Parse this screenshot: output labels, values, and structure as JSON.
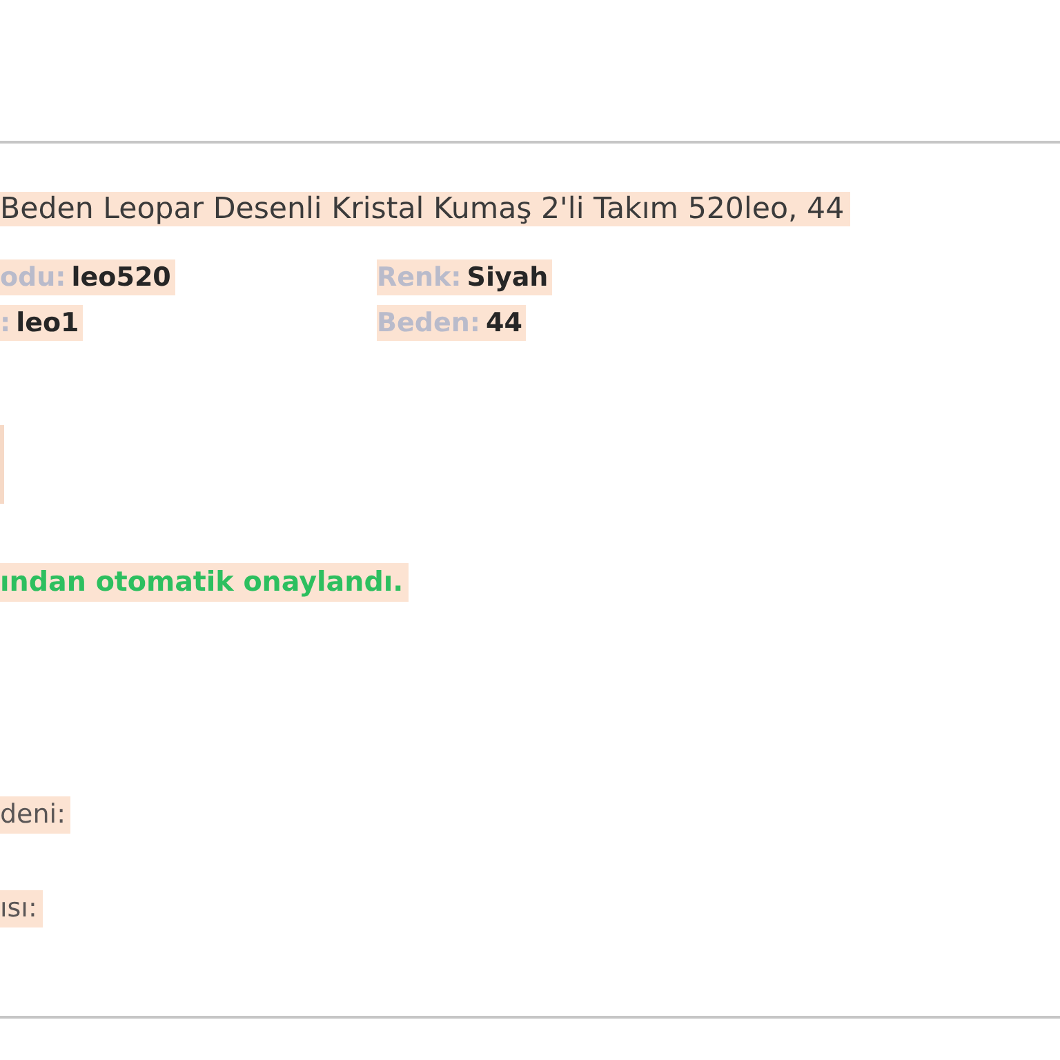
{
  "product_title": "Beden Leopar Desenli Kristal Kumaş 2'li Takım 520leo, 44",
  "attributes": [
    {
      "label": "odu:",
      "value": "leo520"
    },
    {
      "label": "Renk:",
      "value": "Siyah"
    },
    {
      "label": ":",
      "value": "leo1"
    },
    {
      "label": "Beden:",
      "value": "44"
    }
  ],
  "approval_note": "ından otomatik onaylandı.",
  "field_labels": [
    "deni:",
    "ısı:"
  ]
}
